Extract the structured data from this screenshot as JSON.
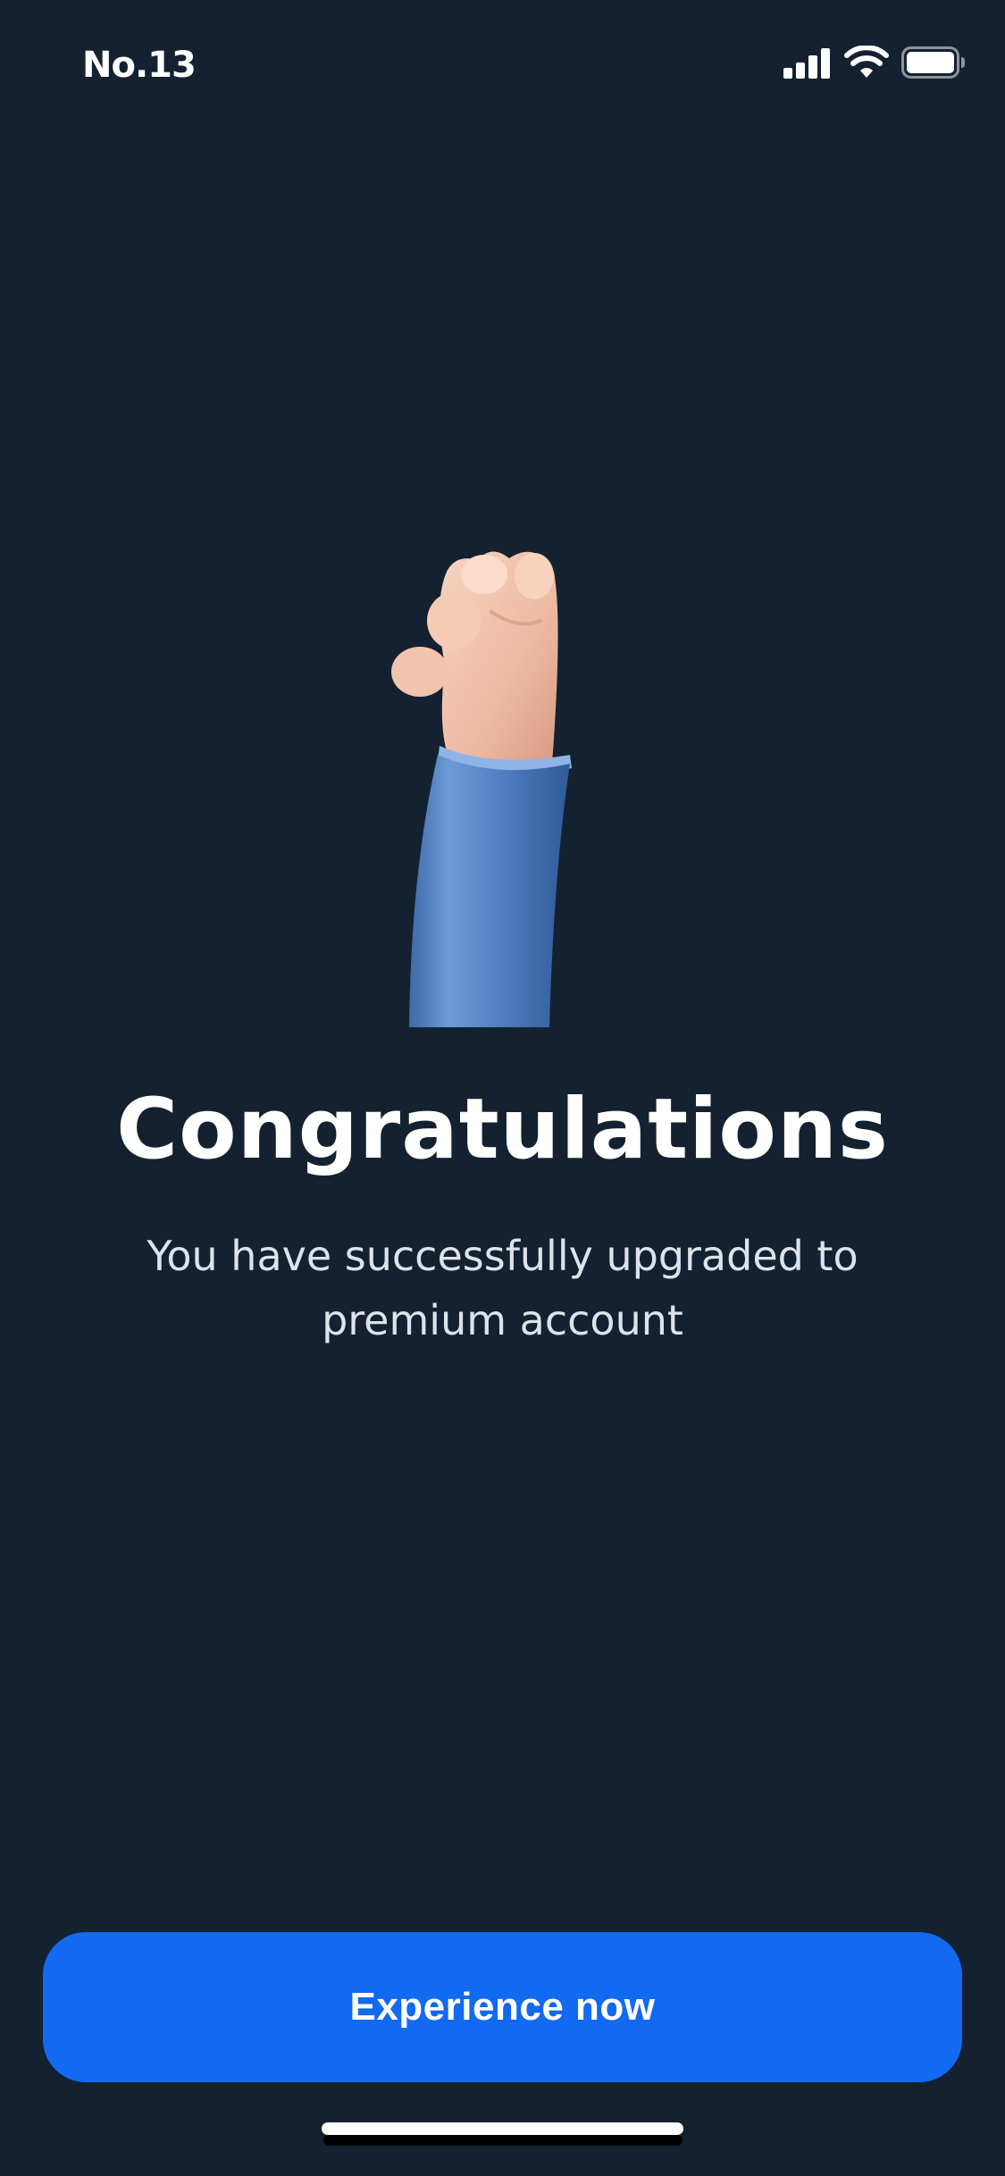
{
  "status_bar": {
    "carrier": "No.13",
    "icons": [
      "cellular-signal-icon",
      "wifi-icon",
      "battery-icon"
    ]
  },
  "illustration": {
    "icon": "raised-hand-icon"
  },
  "main": {
    "title": "Congratulations",
    "subtitle": "You have successfully upgraded to premium account"
  },
  "cta": {
    "label": "Experience now"
  },
  "colors": {
    "background": "#142130",
    "accent": "#116af0",
    "text_primary": "#ffffff",
    "text_secondary": "#dde3ea"
  }
}
